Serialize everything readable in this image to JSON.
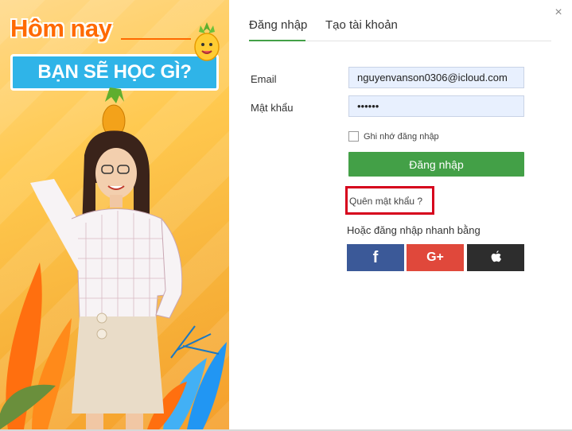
{
  "promo": {
    "headline1": "Hôm nay",
    "headline2": "BẠN SẼ HỌC GÌ?"
  },
  "tabs": [
    {
      "label": "Đăng nhập",
      "active": true
    },
    {
      "label": "Tạo tài khoản",
      "active": false
    }
  ],
  "form": {
    "email_label": "Email",
    "email_value": "nguyenvanson0306@icloud.com",
    "password_label": "Mật khẩu",
    "password_value": "••••••",
    "remember_label": "Ghi nhớ đăng nhập",
    "login_button": "Đăng nhập",
    "forgot_link": "Quên mật khẩu ?",
    "quick_login_text": "Hoặc đăng nhập nhanh bằng"
  },
  "social": {
    "facebook": "f",
    "google": "G+"
  },
  "close": "×",
  "colors": {
    "accent_green": "#43a047",
    "facebook": "#3b5998",
    "google": "#e0483b",
    "apple": "#2d2d2d",
    "highlight_red": "#d6001c"
  }
}
